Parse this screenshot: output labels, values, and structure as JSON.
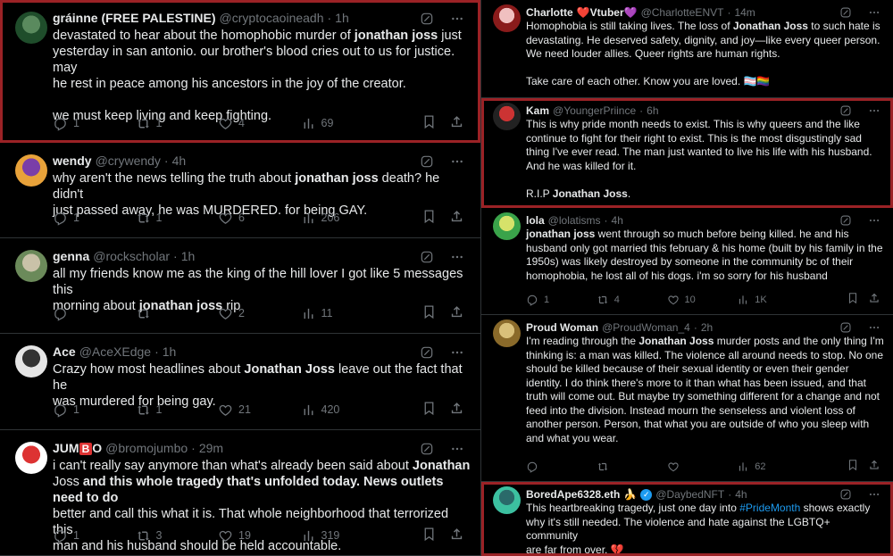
{
  "colors": {
    "background": "#000000",
    "text": "#e7e9ea",
    "muted": "#71767b",
    "highlight_border": "#9b2226",
    "link": "#1d9bf0"
  },
  "icons": {
    "grok": "grok-icon",
    "more": "more-icon",
    "reply": "reply-icon",
    "retweet": "retweet-icon",
    "like": "heart-icon",
    "views": "views-icon",
    "bookmark": "bookmark-icon",
    "share": "share-icon"
  },
  "left_column": [
    {
      "name": "gráinne (FREE PALESTINE)",
      "handle": "@cryptocaoineadh",
      "time": "1h",
      "lines": [
        [
          "devastated to hear about the homophobic murder of ",
          "jonathan joss",
          " just"
        ],
        [
          "yesterday in san antonio. our brother's blood cries out to us for justice. may"
        ],
        [
          "he rest in peace among his ancestors in the joy of the creator."
        ],
        [
          ""
        ],
        [
          "we must keep living and keep fighting."
        ]
      ],
      "reply": "1",
      "retweet": "1",
      "like": "4",
      "views": "69"
    },
    {
      "name": "wendy",
      "handle": "@crywendy",
      "time": "4h",
      "lines": [
        [
          "why aren't the news telling the truth about ",
          "jonathan joss",
          " death? he didn't"
        ],
        [
          "just passed away, he was MURDERED. for being GAY."
        ]
      ],
      "reply": "1",
      "retweet": "1",
      "like": "6",
      "views": "206"
    },
    {
      "name": "genna",
      "handle": "@rockscholar",
      "time": "1h",
      "lines": [
        [
          "all my friends know me as the king of the hill lover I got like 5 messages this"
        ],
        [
          "morning about ",
          "jonathan joss",
          " rip"
        ]
      ],
      "reply": "",
      "retweet": "",
      "like": "2",
      "views": "11"
    },
    {
      "name": "Ace",
      "handle": "@AceXEdge",
      "time": "1h",
      "lines": [
        [
          "Crazy how most headlines about ",
          "Jonathan Joss",
          " leave out the fact that he"
        ],
        [
          "was murdered for being gay."
        ]
      ],
      "reply": "1",
      "retweet": "1",
      "like": "21",
      "views": "420"
    },
    {
      "name_prefix": "JUM",
      "name_badge": "B",
      "name_suffix": "O",
      "handle": "@bromojumbo",
      "time": "29m",
      "lines": [
        [
          "i can't really say anymore than what's already been said about ",
          "Jonathan"
        ],
        [
          "Joss",
          " and this whole tragedy that's unfolded today. News outlets need to do"
        ],
        [
          "better and call this what it is. That whole neighborhood that terrorized this"
        ],
        [
          "man and his husband should be held accountable."
        ]
      ],
      "reply": "1",
      "retweet": "3",
      "like": "19",
      "views": "319"
    }
  ],
  "right_column": [
    {
      "name": "Charlotte",
      "name_emoji": "❤️Vtuber💜",
      "handle": "@CharlotteENVT",
      "time": "14m",
      "lines": [
        [
          "Homophobia is still taking lives. The loss of ",
          "Jonathan Joss",
          " to such hate is"
        ],
        [
          "devastating. He deserved safety, dignity, and joy—like every queer person."
        ],
        [
          "We need louder allies. Queer rights are human rights."
        ],
        [
          ""
        ],
        [
          "Take care of each other. Know you are loved. 🏳️‍⚧️🏳️‍🌈"
        ]
      ]
    },
    {
      "name": "Kam",
      "handle": "@YoungerPriince",
      "time": "6h",
      "lines": [
        [
          "This is why pride month needs to exist. This is why queers and the like"
        ],
        [
          "continue to fight for their right to exist. This is the most disgustingly sad"
        ],
        [
          "thing I've ever read. The man just wanted to live his life with his husband."
        ],
        [
          "And he was killed for it."
        ],
        [
          ""
        ],
        [
          "R.I.P ",
          "Jonathan Joss",
          "."
        ]
      ]
    },
    {
      "name": "lola",
      "handle": "@lolatisms",
      "time": "4h",
      "lines": [
        [
          "",
          "jonathan joss",
          " went through so much before being killed. he and his"
        ],
        [
          "husband only got married this february & his home (built by his family in the"
        ],
        [
          "1950s) was likely destroyed by someone in the community bc of their"
        ],
        [
          "homophobia, he lost all of his dogs. i'm so sorry for his husband"
        ]
      ],
      "reply": "1",
      "retweet": "4",
      "like": "10",
      "views": "1K"
    },
    {
      "name": "Proud Woman",
      "handle": "@ProudWoman_4",
      "time": "2h",
      "lines": [
        [
          "I'm reading through the ",
          "Jonathan Joss",
          " murder posts and the only thing I'm"
        ],
        [
          "thinking is: a man was killed. The violence all around needs to stop. No one"
        ],
        [
          "should be killed because of their sexual identity or even their gender"
        ],
        [
          "identity. I do think there's more to it than what has been issued, and that"
        ],
        [
          "truth will come out. But maybe try something different for a change and not"
        ],
        [
          "feed into the division. Instead mourn the senseless and violent loss of"
        ],
        [
          "another person. Person, that what you are outside of who you sleep with"
        ],
        [
          "and what you wear."
        ]
      ],
      "reply": "",
      "retweet": "",
      "like": "",
      "views": "62"
    },
    {
      "name": "BoredApe6328.eth",
      "name_emoji": "🍌",
      "handle": "@DaybedNFT",
      "time": "4h",
      "line1_pre": "This heartbreaking tragedy, just one day into ",
      "hashtag": "#PrideMonth",
      "line1_post": " shows exactly",
      "lines": [
        [
          "why it's still needed. The violence and hate against the LGBTQ+ community"
        ],
        [
          "are far from over. 💔"
        ]
      ]
    }
  ]
}
